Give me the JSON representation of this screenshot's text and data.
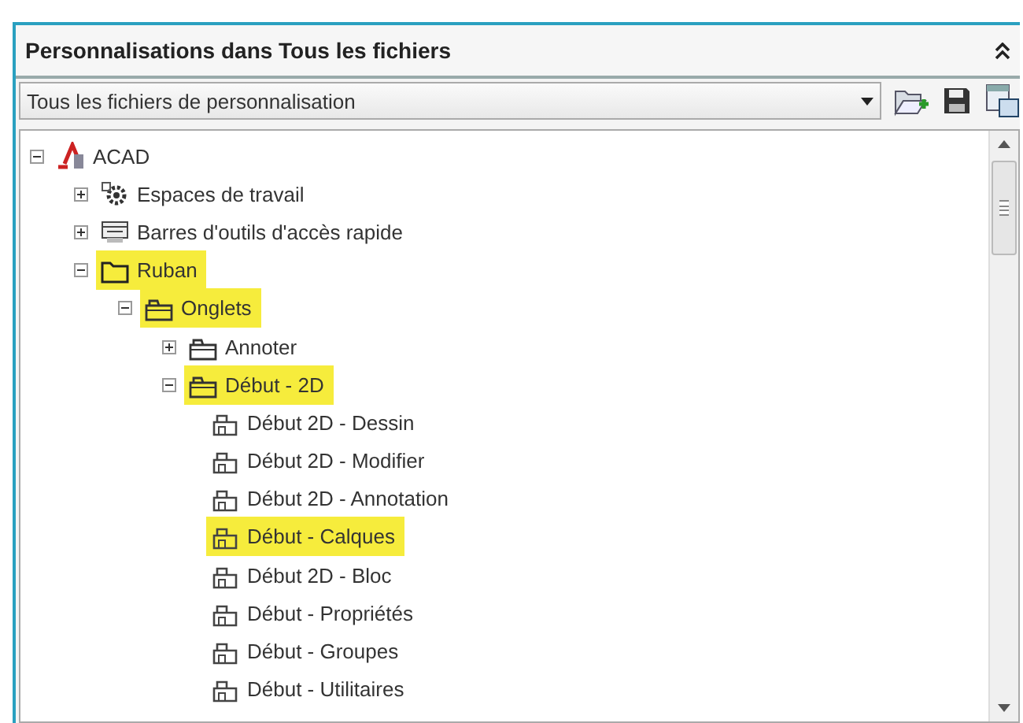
{
  "panel": {
    "title": "Personnalisations dans Tous les fichiers"
  },
  "file_selector": {
    "value": "Tous les fichiers de personnalisation"
  },
  "tree": [
    {
      "label": "ACAD",
      "kind": "acad",
      "expanded": true,
      "highlighted": false,
      "children": [
        {
          "label": "Espaces de travail",
          "kind": "gear",
          "expanded": false,
          "highlighted": false
        },
        {
          "label": "Barres d'outils d'accès rapide",
          "kind": "toolbar",
          "expanded": false,
          "highlighted": false
        },
        {
          "label": "Ruban",
          "kind": "folder",
          "expanded": true,
          "highlighted": true,
          "children": [
            {
              "label": "Onglets",
              "kind": "tabs",
              "expanded": true,
              "highlighted": true,
              "children": [
                {
                  "label": "Annoter",
                  "kind": "tabs",
                  "expanded": false,
                  "highlighted": false
                },
                {
                  "label": "Début - 2D",
                  "kind": "tabs",
                  "expanded": true,
                  "highlighted": true,
                  "children": [
                    {
                      "label": "Début 2D - Dessin",
                      "kind": "panel",
                      "highlighted": false
                    },
                    {
                      "label": "Début 2D - Modifier",
                      "kind": "panel",
                      "highlighted": false
                    },
                    {
                      "label": "Début 2D - Annotation",
                      "kind": "panel",
                      "highlighted": false
                    },
                    {
                      "label": "Début - Calques",
                      "kind": "panel",
                      "highlighted": true
                    },
                    {
                      "label": "Début 2D - Bloc",
                      "kind": "panel",
                      "highlighted": false
                    },
                    {
                      "label": "Début - Propriétés",
                      "kind": "panel",
                      "highlighted": false
                    },
                    {
                      "label": "Début - Groupes",
                      "kind": "panel",
                      "highlighted": false
                    },
                    {
                      "label": "Début - Utilitaires",
                      "kind": "panel",
                      "highlighted": false
                    }
                  ]
                }
              ]
            }
          ]
        }
      ]
    }
  ]
}
